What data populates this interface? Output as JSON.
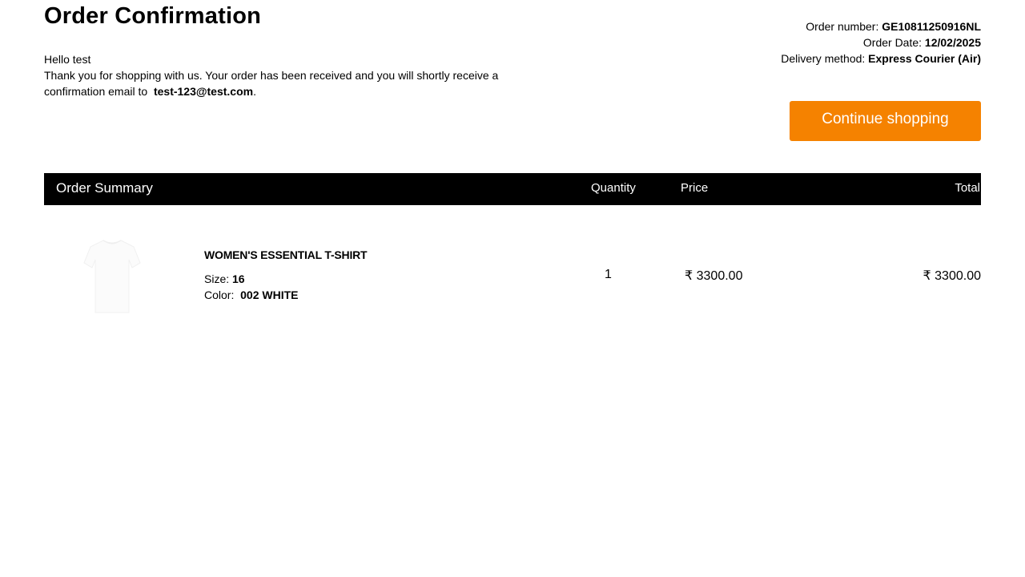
{
  "page": {
    "title": "Order Confirmation"
  },
  "greeting": {
    "hello": "Hello test",
    "message": "Thank you for shopping with us. Your order has been received and you will shortly receive a confirmation email to",
    "email": "test-123@test.com",
    "suffix": "."
  },
  "order_meta": {
    "number_label": "Order number:",
    "number_value": "GE10811250916NL",
    "date_label": "Order Date:",
    "date_value": "12/02/2025",
    "delivery_label": "Delivery method:",
    "delivery_value": "Express Courier (Air)"
  },
  "actions": {
    "continue_label": "Continue shopping",
    "continue_color": "#f58200"
  },
  "summary": {
    "title": "Order Summary",
    "col_quantity": "Quantity",
    "col_price": "Price",
    "col_total": "Total",
    "items": [
      {
        "image_icon": "tshirt-icon",
        "name": "WOMEN'S ESSENTIAL T-SHIRT",
        "size_label": "Size:",
        "size_value": "16",
        "color_label": "Color:",
        "color_value": "002 WHITE",
        "quantity": "1",
        "price": "₹ 3300.00",
        "total": "₹ 3300.00"
      }
    ]
  }
}
